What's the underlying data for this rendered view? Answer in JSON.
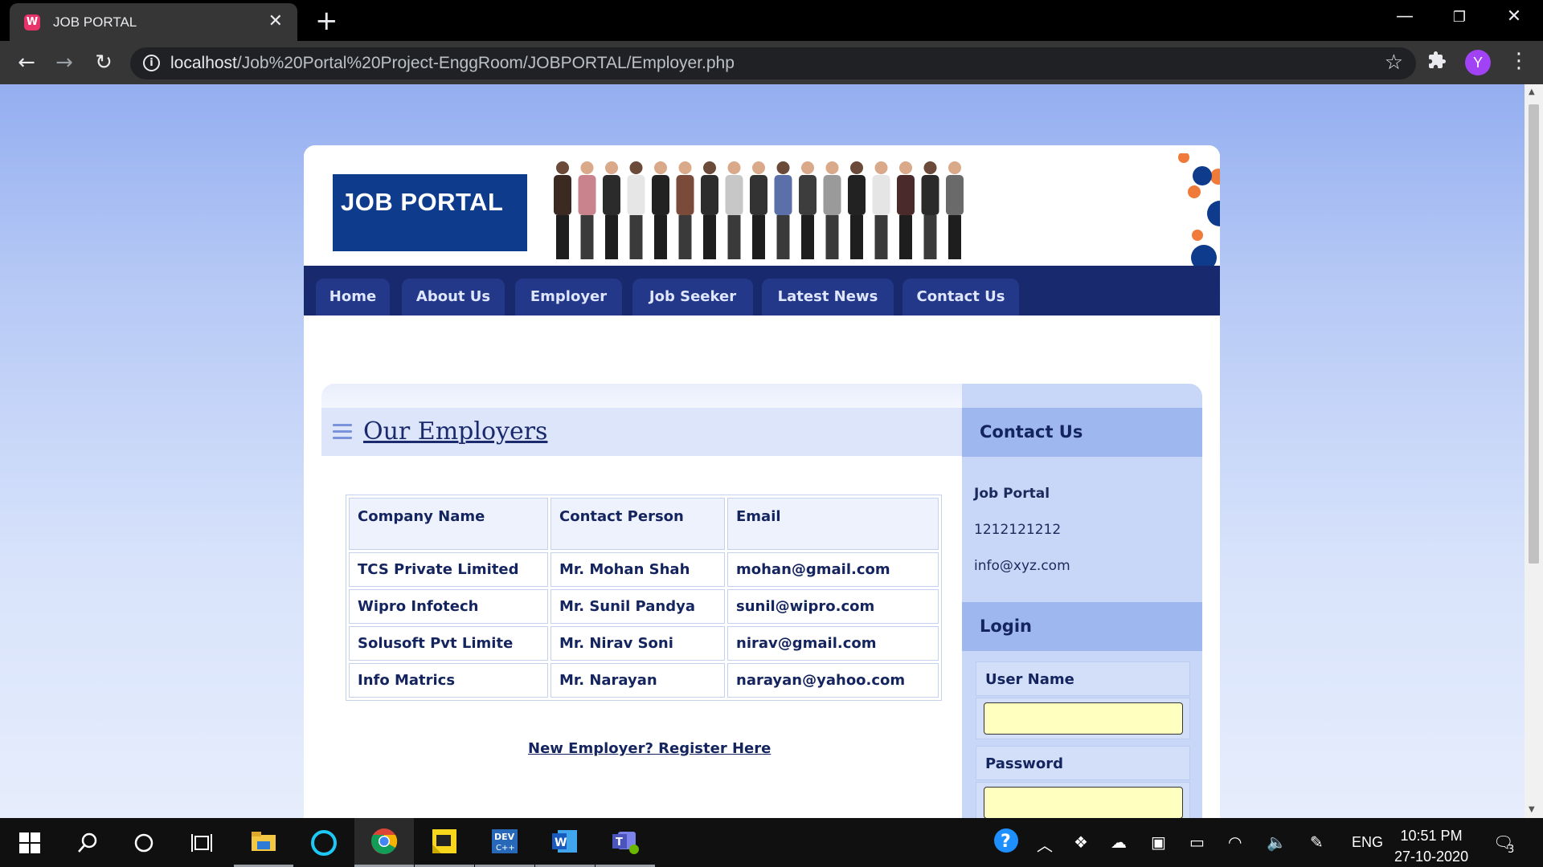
{
  "browser": {
    "tab_title": "JOB PORTAL",
    "favicon_letter": "W",
    "url_host": "localhost",
    "url_path": "/Job%20Portal%20Project-EnggRoom/JOBPORTAL/Employer.php",
    "profile_initial": "Y"
  },
  "site": {
    "logo_text": "JOB PORTAL",
    "nav": [
      "Home",
      "About Us",
      "Employer",
      "Job Seeker",
      "Latest News",
      "Contact Us"
    ]
  },
  "content": {
    "title": "Our Employers",
    "table": {
      "headers": [
        "Company Name",
        "Contact Person",
        "Email"
      ],
      "rows": [
        [
          "TCS Private Limited",
          "Mr. Mohan Shah",
          "mohan@gmail.com"
        ],
        [
          "Wipro Infotech",
          "Mr. Sunil Pandya",
          "sunil@wipro.com"
        ],
        [
          "Solusoft Pvt Limite",
          "Mr. Nirav Soni",
          "nirav@gmail.com"
        ],
        [
          "Info Matrics",
          "Mr. Narayan",
          "narayan@yahoo.com"
        ]
      ]
    },
    "register_link": "New Employer? Register Here"
  },
  "sidebar": {
    "contact_heading": "Contact Us",
    "contact_name": "Job Portal",
    "contact_phone": "1212121212",
    "contact_email": "info@xyz.com",
    "login_heading": "Login",
    "username_label": "User Name",
    "password_label": "Password"
  },
  "taskbar": {
    "lang": "ENG",
    "time": "10:51 PM",
    "date": "27-10-2020",
    "notification_count": "3"
  },
  "colors": {
    "brand_blue": "#0e3b8c",
    "nav_bg": "#18296e",
    "input_bg": "#ffffc0"
  }
}
